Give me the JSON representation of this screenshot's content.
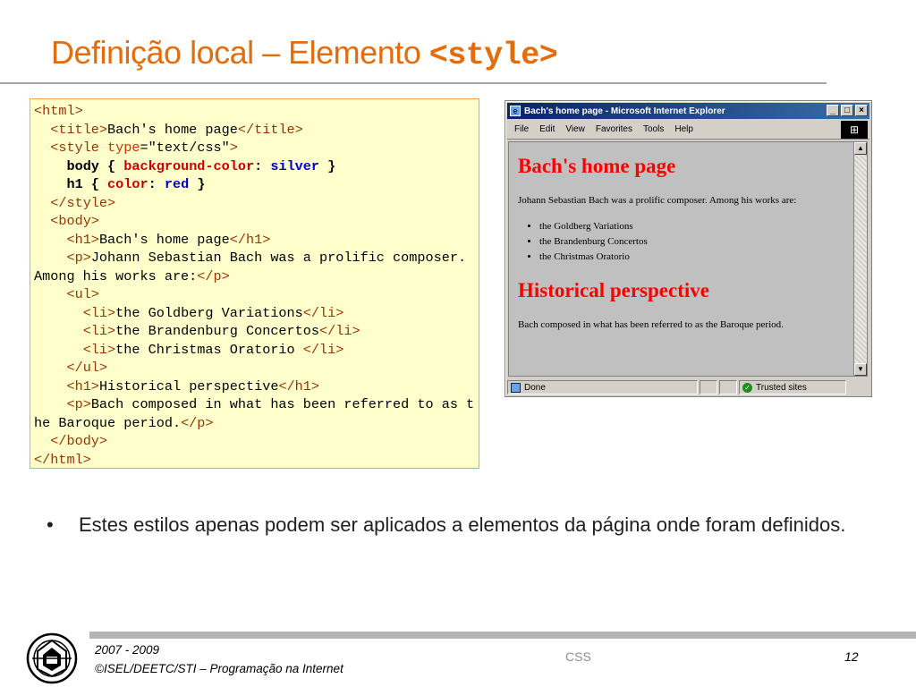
{
  "slide": {
    "title_text": "Definição local – Elemento ",
    "title_code": "<style>"
  },
  "code": {
    "l1": {
      "open": "<html>"
    },
    "l2": {
      "indent": "  ",
      "open": "<title>",
      "text": "Bach's home page",
      "close": "</title>"
    },
    "l3": {
      "indent": "  ",
      "open": "<style ",
      "attr": "type",
      "eq": "=",
      "value": "\"text/css\"",
      "end": ">"
    },
    "l4": {
      "indent": "    ",
      "sel": "body",
      "ob": " { ",
      "prop": "background-color",
      "colon": ": ",
      "val": "silver",
      "cb": " }"
    },
    "l5": {
      "indent": "    ",
      "sel": "h1",
      "ob": " { ",
      "prop": "color",
      "colon": ": ",
      "val": "red",
      "cb": " }"
    },
    "l6": {
      "indent": "  ",
      "close": "</style>"
    },
    "l7": {
      "indent": "  ",
      "open": "<body>"
    },
    "l8": {
      "indent": "    ",
      "open": "<h1>",
      "text": "Bach's home page",
      "close": "</h1>"
    },
    "l9": {
      "indent": "    ",
      "open": "<p>",
      "text": "Johann Sebastian Bach was a prolific composer. Among his works are:",
      "close": "</p>"
    },
    "l10": {
      "indent": "    ",
      "open": "<ul>"
    },
    "l11": {
      "indent": "      ",
      "open": "<li>",
      "text": "the Goldberg Variations",
      "close": "</li>"
    },
    "l12": {
      "indent": "      ",
      "open": "<li>",
      "text": "the Brandenburg Concertos",
      "close": "</li>"
    },
    "l13": {
      "indent": "      ",
      "open": "<li>",
      "text": "the Christmas Oratorio ",
      "close": "</li>"
    },
    "l14": {
      "indent": "    ",
      "close": "</ul>"
    },
    "l15": {
      "indent": "    ",
      "open": "<h1>",
      "text": "Historical perspective",
      "close": "</h1>"
    },
    "l16": {
      "indent": "    ",
      "open": "<p>",
      "text": "Bach composed in what has been referred to as the Baroque period.",
      "close": "</p>"
    },
    "l17": {
      "indent": "  ",
      "close": "</body>"
    },
    "l18": {
      "close": "</html>"
    }
  },
  "browser": {
    "window_title": "Bach's home page - Microsoft Internet Explorer",
    "menu": [
      "File",
      "Edit",
      "View",
      "Favorites",
      "Tools",
      "Help"
    ],
    "heading1": "Bach's home page",
    "intro": "Johann Sebastian Bach was a prolific composer. Among his works are:",
    "works": [
      "the Goldberg Variations",
      "the Brandenburg Concertos",
      "the Christmas Oratorio"
    ],
    "heading2": "Historical perspective",
    "closing": "Bach composed in what has been referred to as the Baroque period.",
    "status_done": "Done",
    "status_zone": "Trusted sites",
    "background_color": "#c0c0c0",
    "heading_color": "#ff0000"
  },
  "bullet": {
    "marker": "•",
    "text": "Estes estilos apenas podem ser aplicados a elementos da página onde foram definidos."
  },
  "footer": {
    "years": "2007 - 2009",
    "course": "©ISEL/DEETC/STI – Programação na Internet",
    "topic": "CSS",
    "page": "12"
  },
  "colors": {
    "title": "#e46c0a",
    "code_bg": "#ffffcc",
    "code_border": "#f4a44a"
  }
}
